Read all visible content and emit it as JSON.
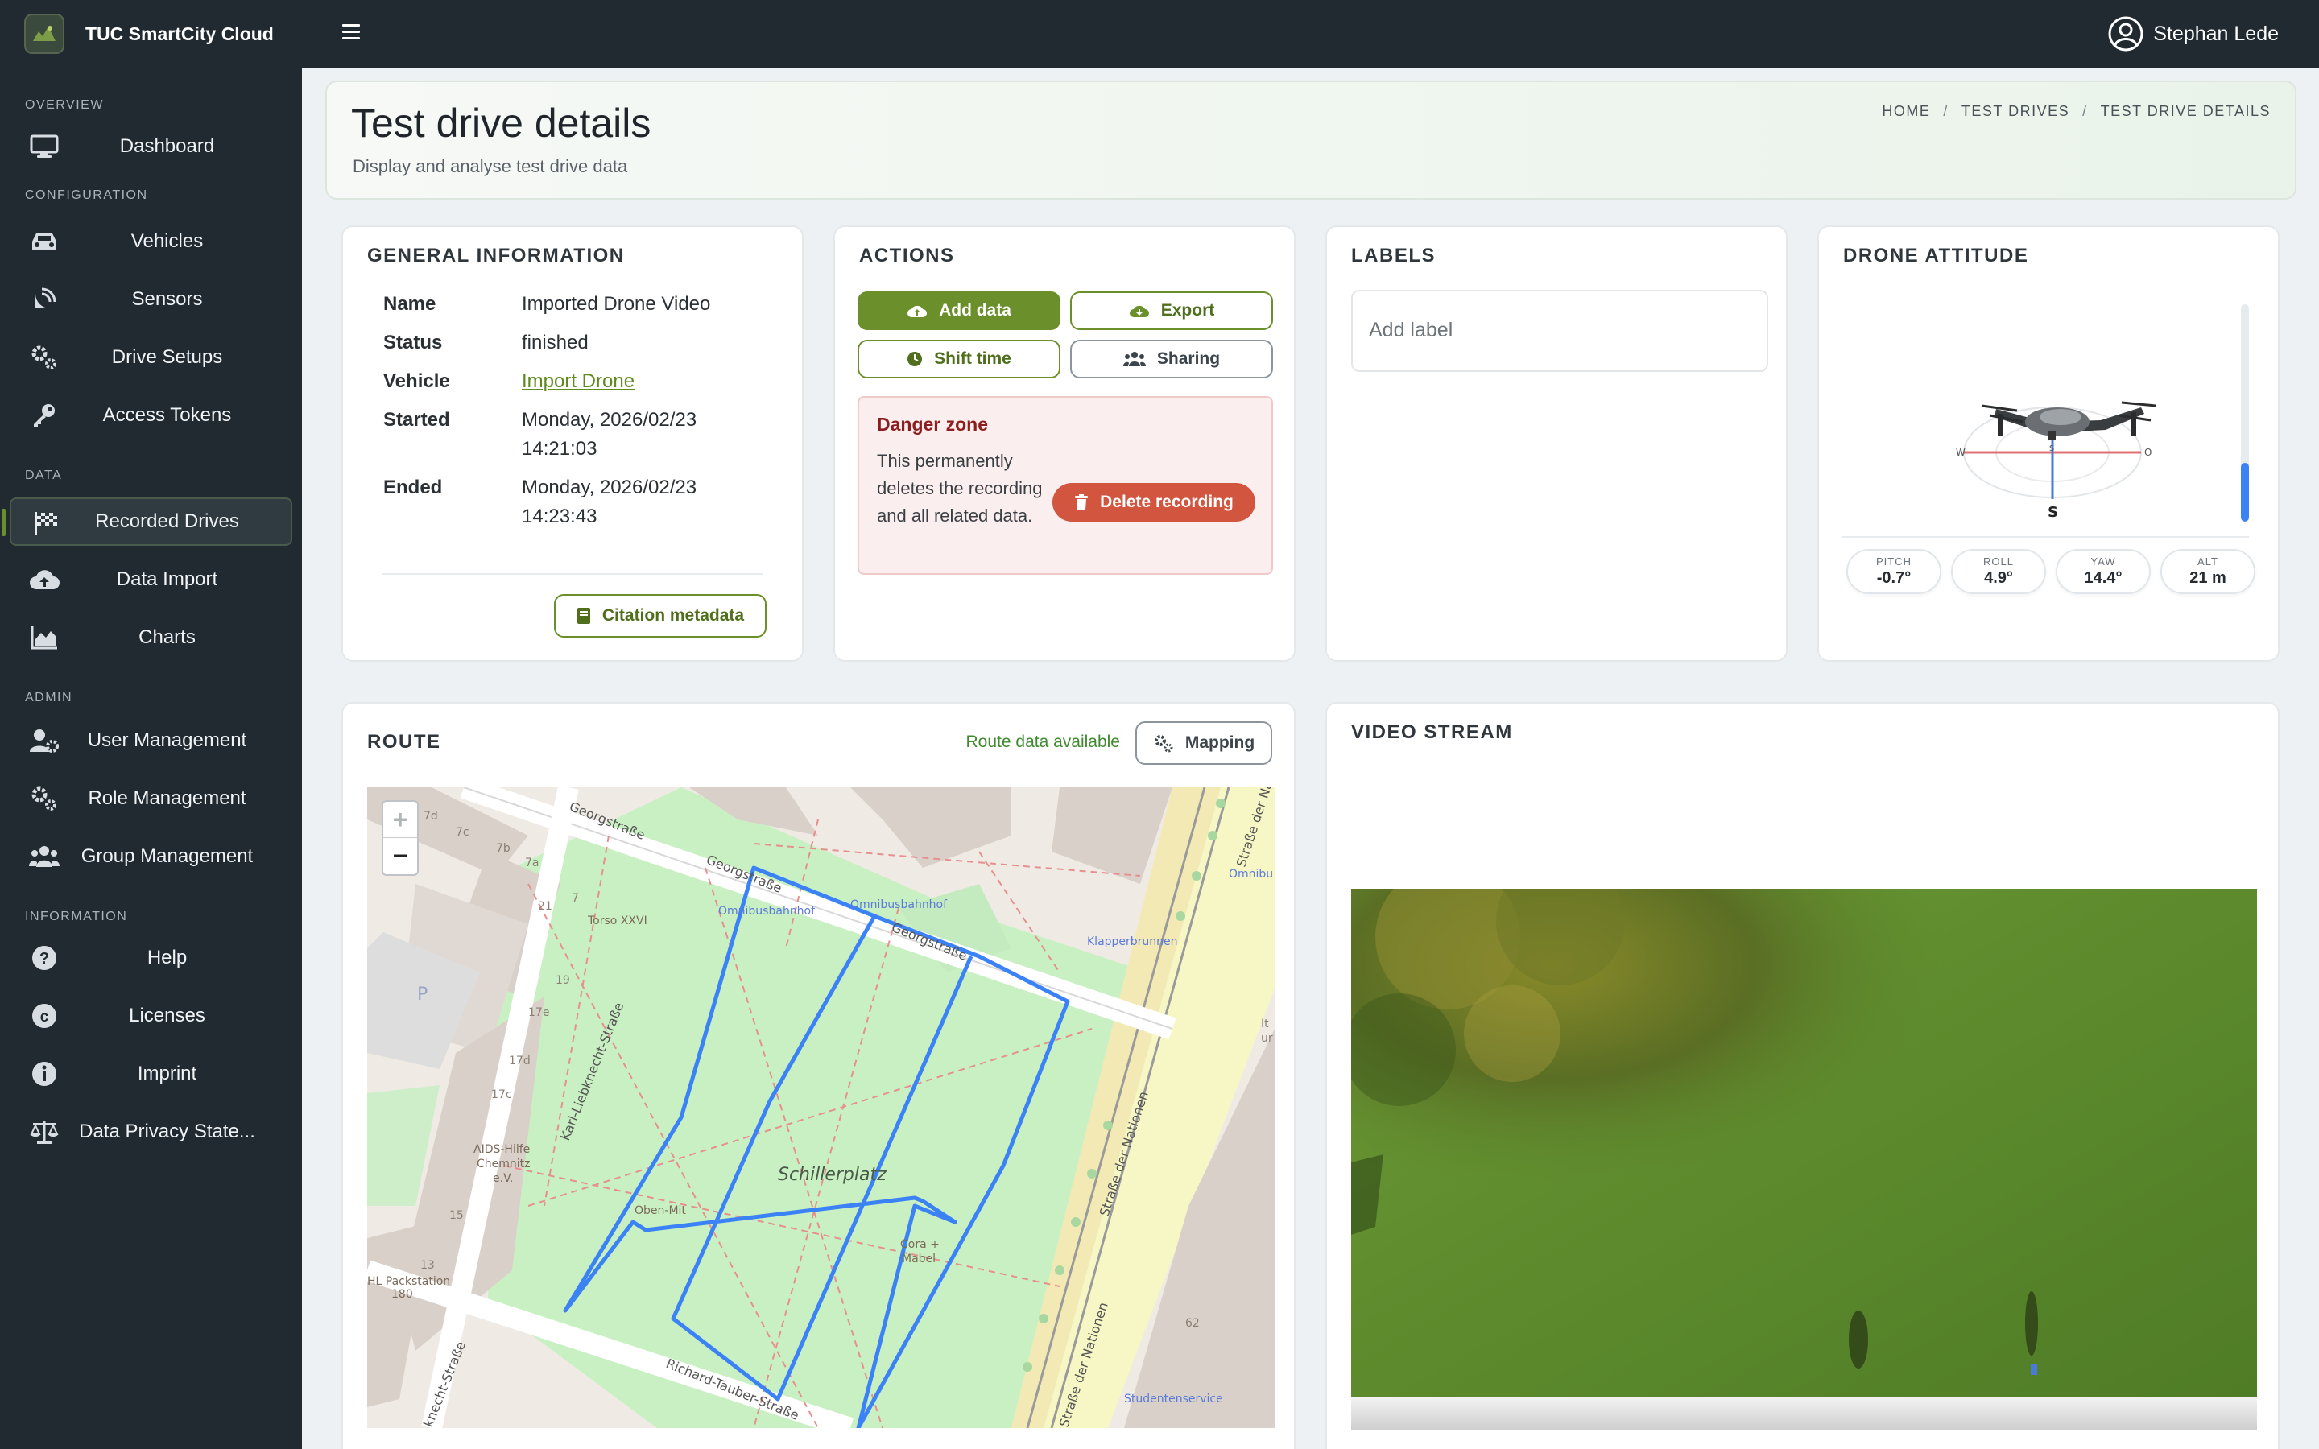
{
  "app": {
    "title": "TUC SmartCity Cloud",
    "user": "Stephan Lede"
  },
  "sidebar": {
    "sections": {
      "overview": "OVERVIEW",
      "configuration": "CONFIGURATION",
      "data": "DATA",
      "admin": "ADMIN",
      "information": "INFORMATION"
    },
    "items": {
      "dashboard": "Dashboard",
      "vehicles": "Vehicles",
      "sensors": "Sensors",
      "drive_setups": "Drive Setups",
      "access_tokens": "Access Tokens",
      "recorded_drives": "Recorded Drives",
      "data_import": "Data Import",
      "charts": "Charts",
      "user_management": "User Management",
      "role_management": "Role Management",
      "group_management": "Group Management",
      "help": "Help",
      "licenses": "Licenses",
      "imprint": "Imprint",
      "privacy": "Data Privacy State..."
    }
  },
  "header": {
    "title": "Test drive details",
    "subtitle": "Display and analyse test drive data",
    "breadcrumb": [
      "HOME",
      "TEST DRIVES",
      "TEST DRIVE DETAILS"
    ]
  },
  "general": {
    "title": "GENERAL INFORMATION",
    "rows": [
      {
        "k": "Name",
        "v": "Imported Drone Video"
      },
      {
        "k": "Status",
        "v": "finished"
      },
      {
        "k": "Vehicle",
        "v": "Import Drone"
      },
      {
        "k": "Started",
        "v1": "Monday, 2026/02/23",
        "v2": "14:21:03"
      },
      {
        "k": "Ended",
        "v1": "Monday, 2026/02/23",
        "v2": "14:23:43"
      }
    ],
    "citation_button": "Citation metadata"
  },
  "actions": {
    "title": "ACTIONS",
    "add_data": "Add data",
    "export": "Export",
    "shift_time": "Shift time",
    "sharing": "Sharing",
    "danger_title": "Danger zone",
    "danger_text": "This permanently deletes the recording and all related data.",
    "delete_button": "Delete recording"
  },
  "labels": {
    "title": "LABELS",
    "placeholder": "Add label"
  },
  "attitude": {
    "title": "DRONE ATTITUDE",
    "compass": {
      "w": "W",
      "s": "S",
      "o": "O",
      "south": "S"
    },
    "altitude_fraction": 0.27,
    "pills": [
      {
        "label": "PITCH",
        "value": "-0.7°"
      },
      {
        "label": "ROLL",
        "value": "4.9°"
      },
      {
        "label": "YAW",
        "value": "14.4°"
      },
      {
        "label": "ALT",
        "value": "21 m"
      }
    ]
  },
  "route": {
    "title": "ROUTE",
    "status": "Route data available",
    "mapping_button": "Mapping",
    "zoom_in": "+",
    "zoom_out": "−",
    "map_labels": {
      "georg1": "Georgstraße",
      "georg2": "Georgstraße",
      "georg3": "Georgstraße",
      "karl": "Karl-Liebknecht-Straße",
      "schiller": "Schillerplatz",
      "nationen1": "Straße der Nationen",
      "nationen2": "Straße der Nationen",
      "nationen3": "Straße der Na",
      "richard": "Richard-Tauber-Straße",
      "knecht": "knecht-Straße",
      "omnibus1": "Omnibusbahnhof",
      "omnibus2": "Omnibusbahnhof",
      "omnibus3": "Omnibu",
      "klapper": "Klapperbrunnen",
      "torso": "Torso XXVI",
      "aids1": "AIDS-Hilfe",
      "aids2": "Chemnitz",
      "aids3": "e.V.",
      "oben": "Oben-Mit",
      "cora1": "Cora +",
      "cora2": "Mabel",
      "dhl1": "HL Packstation",
      "dhl2": "180",
      "studenten": "Studentenservice",
      "n7d": "7d",
      "n7c": "7c",
      "n7b": "7b",
      "n7a": "7a",
      "n21": "21",
      "n7": "7",
      "n19": "19",
      "n17e": "17e",
      "n17d": "17d",
      "n17c": "17c",
      "n15": "15",
      "n13": "13",
      "n62": "62",
      "p": "P",
      "it": "It",
      "ur": "ur"
    }
  },
  "video": {
    "title": "VIDEO STREAM"
  }
}
